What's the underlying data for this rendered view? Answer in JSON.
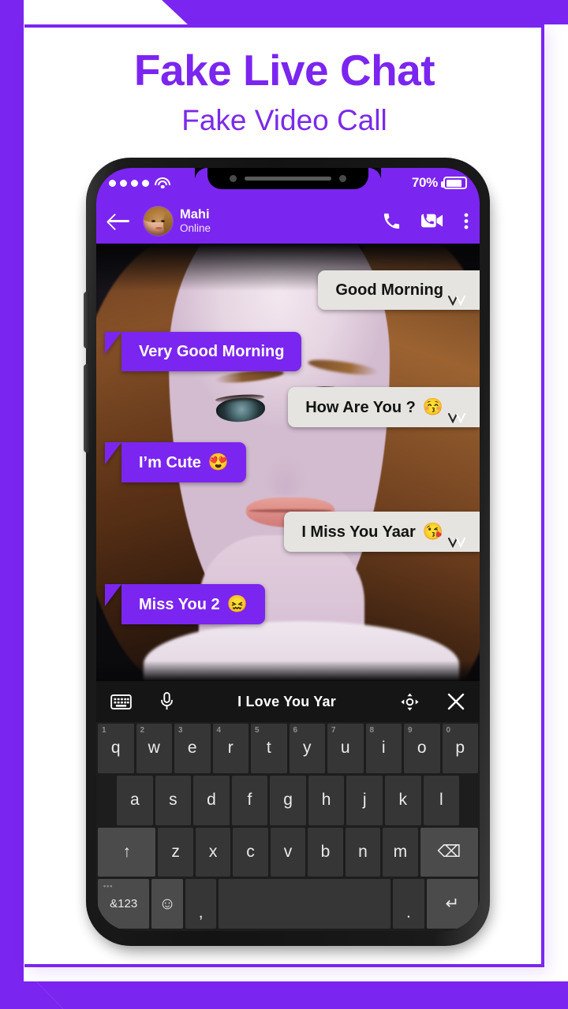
{
  "theme": {
    "accent": "#7b25f0",
    "bubble_in_bg": "#e5e4e0",
    "bubble_out_bg": "#7b25f0",
    "keyboard_bg": "#1d1d1d"
  },
  "headings": {
    "title": "Fake Live Chat",
    "subtitle": "Fake Video Call"
  },
  "phone": {
    "status_bar": {
      "signal_dots": 4,
      "wifi_icon": "wifi-icon",
      "battery_percent": "70%",
      "battery_icon": "battery-icon"
    },
    "chat_header": {
      "back_icon": "back-arrow-icon",
      "avatar": "contact-avatar",
      "name": "Mahi",
      "status": "Online",
      "call_icon": "phone-call-icon",
      "video_icon": "video-call-icon",
      "menu_icon": "overflow-menu-icon"
    },
    "messages": [
      {
        "id": "m1",
        "text": "Good Morning",
        "emoji": "",
        "side": "in",
        "ticks": true
      },
      {
        "id": "m2",
        "text": "Very Good Morning",
        "emoji": "",
        "side": "out",
        "ticks": false
      },
      {
        "id": "m3",
        "text": "How Are You ?",
        "emoji": "😚",
        "side": "in",
        "ticks": true
      },
      {
        "id": "m4",
        "text": "I’m Cute",
        "emoji": "😍",
        "side": "out",
        "ticks": false
      },
      {
        "id": "m5",
        "text": "I Miss You Yaar",
        "emoji": "😘",
        "side": "in",
        "ticks": true
      },
      {
        "id": "m6",
        "text": "Miss You 2",
        "emoji": "😖",
        "side": "out",
        "ticks": false
      }
    ],
    "keyboard": {
      "toolbar": {
        "keyboard_icon": "keyboard-icon",
        "mic_icon": "microphone-icon",
        "suggestion": "I Love You Yar",
        "cursor_icon": "cursor-move-icon",
        "close_icon": "close-icon"
      },
      "row1": [
        {
          "key": "q",
          "num": "1"
        },
        {
          "key": "w",
          "num": "2"
        },
        {
          "key": "e",
          "num": "3"
        },
        {
          "key": "r",
          "num": "4"
        },
        {
          "key": "t",
          "num": "5"
        },
        {
          "key": "y",
          "num": "6"
        },
        {
          "key": "u",
          "num": "7"
        },
        {
          "key": "i",
          "num": "8"
        },
        {
          "key": "o",
          "num": "9"
        },
        {
          "key": "p",
          "num": "0"
        }
      ],
      "row2": [
        "a",
        "s",
        "d",
        "f",
        "g",
        "h",
        "j",
        "k",
        "l"
      ],
      "row3": [
        "z",
        "x",
        "c",
        "v",
        "b",
        "n",
        "m"
      ],
      "shift_label": "↑",
      "backspace_label": "⌫",
      "symbols_label": "&123",
      "emoji_label": "☺",
      "comma_label": ",",
      "space_label": "",
      "period_label": ".",
      "enter_label": "↵"
    }
  }
}
